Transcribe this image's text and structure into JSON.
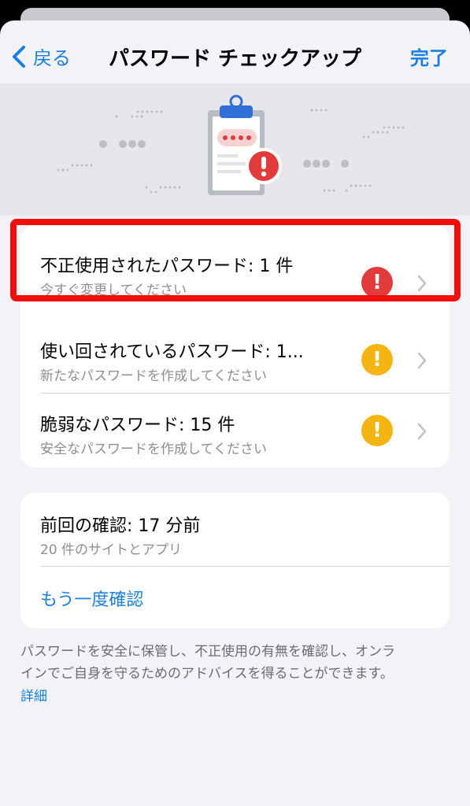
{
  "nav": {
    "back_label": "戻る",
    "title": "パスワード チェックアップ",
    "done_label": "完了"
  },
  "issues": [
    {
      "title": "不正使用されたパスワード: 1 件",
      "subtitle": "今すぐ変更してください",
      "badge": "!",
      "badge_color": "#e23b3b"
    },
    {
      "title": "使い回されているパスワード: 1...",
      "subtitle": "新たなパスワードを作成してください",
      "badge": "!",
      "badge_color": "#f4b512"
    },
    {
      "title": "脆弱なパスワード: 15 件",
      "subtitle": "安全なパスワードを作成してください",
      "badge": "!",
      "badge_color": "#f4b512"
    }
  ],
  "last_check": {
    "title": "前回の確認: 17 分前",
    "subtitle": "20 件のサイトとアプリ",
    "recheck_label": "もう一度確認"
  },
  "footer": {
    "description_line1": "パスワードを安全に保管し、不正使用の有無を確認し、オンラ",
    "description_line2": "インでご自身を守るためのアドバイスを得ることができます。",
    "link_label": "詳細"
  },
  "colors": {
    "accent": "#1a7fe0",
    "danger": "#e23b3b",
    "warning": "#f4b512",
    "highlight": "#f20d0d"
  },
  "icons": {
    "back": "chevron-left-icon",
    "hero": "clipboard-password-alert-icon",
    "row_disclosure": "chevron-right-icon",
    "alert": "exclamation-icon"
  }
}
